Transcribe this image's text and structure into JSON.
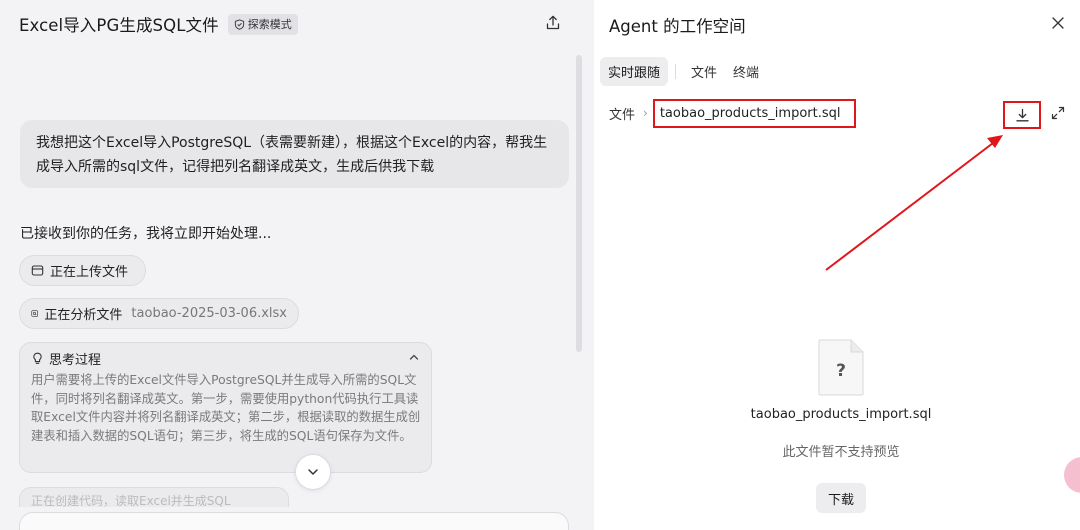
{
  "chat": {
    "title": "Excel导入PG生成SQL文件",
    "mode_badge": "探索模式",
    "user_message": "我想把这个Excel导入PostgreSQL（表需要新建），根据这个Excel的内容，帮我生成导入所需的sql文件，记得把列名翻译成英文，生成后供我下载",
    "ack_text": "已接收到你的任务，我将立即开始处理...",
    "steps": {
      "upload": "正在上传文件",
      "analyze": "正在分析文件",
      "analyze_file": "taobao-2025-03-06.xlsx"
    },
    "thinking": {
      "title": "思考过程",
      "body": "用户需要将上传的Excel文件导入PostgreSQL并生成导入所需的SQL文件，同时将列名翻译成英文。第一步，需要使用python代码执行工具读取Excel文件内容并将列名翻译成英文；第二步，根据读取的数据生成创建表和插入数据的SQL语句；第三步，将生成的SQL语句保存为文件。"
    },
    "partial_step": "正在创建代码，读取Excel并生成SQL"
  },
  "workspace": {
    "title": "Agent 的工作空间",
    "tabs": [
      {
        "label": "实时跟随",
        "active": true
      },
      {
        "label": "文件",
        "active": false
      },
      {
        "label": "终端",
        "active": false
      }
    ],
    "breadcrumb_root": "文件",
    "breadcrumb_file": "taobao_products_import.sql",
    "preview_icon_glyph": "?",
    "preview_file_name": "taobao_products_import.sql",
    "preview_note": "此文件暂不支持预览",
    "download_label": "下载"
  },
  "colors": {
    "highlight_red": "#e0161b",
    "panel_bg": "#f3f3f5",
    "bubble_bg": "#e7e7ea"
  },
  "icons": [
    "shield-icon",
    "share-icon",
    "folder-icon",
    "file-scan-icon",
    "lightbulb-icon",
    "chevron-up-icon",
    "chevron-down-icon",
    "close-icon",
    "download-icon",
    "expand-icon",
    "file-unknown-icon"
  ]
}
